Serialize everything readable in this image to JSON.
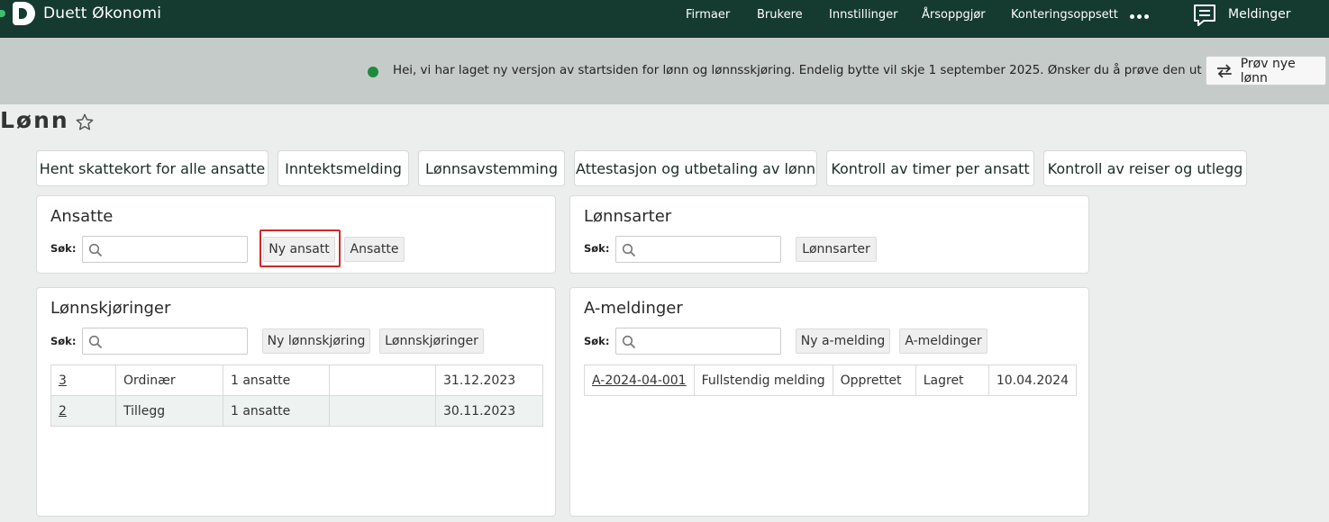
{
  "app": {
    "brand": "Duett Økonomi"
  },
  "nav": {
    "items": [
      "Firmaer",
      "Brukere",
      "Innstillinger",
      "Årsoppgjør",
      "Konteringsoppsett"
    ],
    "messages_label": "Meldinger"
  },
  "banner": {
    "text": "Hei, vi har laget ny versjon av startsiden for lønn og lønnsskjøring. Endelig bytte vil skje 1 september 2025. Ønsker du å prøve den ut nå?",
    "button_label": "Prøv nye lønn"
  },
  "page": {
    "title": "Lønn"
  },
  "quick_buttons": [
    "Hent skattekort for alle ansatte",
    "Inntektsmelding",
    "Lønnsavstemming",
    "Attestasjon og utbetaling av lønn",
    "Kontroll av timer per ansatt",
    "Kontroll av reiser og utlegg"
  ],
  "panels": {
    "ansatte": {
      "title": "Ansatte",
      "search_label": "Søk:",
      "new_button": "Ny ansatt",
      "list_button": "Ansatte"
    },
    "lonnsarter": {
      "title": "Lønnsarter",
      "search_label": "Søk:",
      "list_button": "Lønnsarter"
    },
    "lonnskjoringer": {
      "title": "Lønnskjøringer",
      "search_label": "Søk:",
      "new_button": "Ny lønnskjøring",
      "list_button": "Lønnskjøringer",
      "rows": [
        {
          "id": "3",
          "type": "Ordinær",
          "count": "1 ansatte",
          "extra": "",
          "date": "31.12.2023"
        },
        {
          "id": "2",
          "type": "Tillegg",
          "count": "1 ansatte",
          "extra": "",
          "date": "30.11.2023"
        }
      ]
    },
    "ameldinger": {
      "title": "A-meldinger",
      "search_label": "Søk:",
      "new_button": "Ny a-melding",
      "list_button": "A-meldinger",
      "rows": [
        {
          "id": "A-2024-04-001",
          "type": "Fullstendig melding",
          "status": "Opprettet",
          "state": "Lagret",
          "date": "10.04.2024"
        }
      ]
    }
  },
  "colors": {
    "topbar": "#153a30",
    "banner": "#c5cbc9",
    "accent": "#1f8a3d",
    "highlight": "#d1262d"
  }
}
